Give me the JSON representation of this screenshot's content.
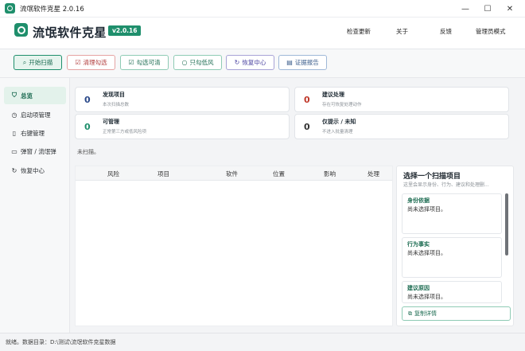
{
  "window": {
    "title": "流氓软件克星 2.0.16",
    "controls": {
      "minimize": "—",
      "maximize": "☐",
      "close": "✕"
    }
  },
  "header": {
    "brand": "流氓软件克星",
    "version": "v2.0.16",
    "menu": [
      "检查更新",
      "关于",
      "反馈",
      "管理员模式"
    ]
  },
  "toolbar": {
    "buttons": [
      {
        "label": "开始扫描",
        "icon": "search-icon"
      },
      {
        "label": "清理勾选",
        "icon": "checkbox-icon"
      },
      {
        "label": "勾选可清",
        "icon": "checkbox-icon"
      },
      {
        "label": "只勾低风",
        "icon": "circle-icon"
      },
      {
        "label": "恢复中心",
        "icon": "restore-icon"
      },
      {
        "label": "证据报告",
        "icon": "report-icon"
      }
    ]
  },
  "sidebar": {
    "items": [
      {
        "label": "总览",
        "icon": "shield-icon",
        "active": true
      },
      {
        "label": "启动项管理",
        "icon": "clock-icon",
        "active": false
      },
      {
        "label": "右键管理",
        "icon": "file-icon",
        "active": false
      },
      {
        "label": "弹窗 / 流氓弹",
        "icon": "window-icon",
        "active": false
      },
      {
        "label": "恢复中心",
        "icon": "restore-icon",
        "active": false
      }
    ]
  },
  "summary": {
    "cards": [
      {
        "value": "0",
        "title": "发现项目",
        "desc": "本次扫描总数",
        "color": "#2b4a8a"
      },
      {
        "value": "0",
        "title": "建议处理",
        "desc": "存在可恢复处理动作",
        "color": "#c0392b"
      },
      {
        "value": "0",
        "title": "可管理",
        "desc": "正常第三方或低风险项",
        "color": "#1f8f6c"
      },
      {
        "value": "0",
        "title": "仅提示 / 未知",
        "desc": "不进入批量清理",
        "color": "#333333"
      }
    ]
  },
  "status_message": "未扫描。",
  "table": {
    "columns": [
      "风险",
      "项目",
      "软件",
      "位置",
      "影响",
      "处理"
    ],
    "rows": []
  },
  "detail": {
    "title": "选择一个扫描项目",
    "subtitle": "这里会显示身份、行为、建议和处理删...",
    "sections": [
      {
        "heading": "身份依据",
        "body": "尚未选择项目。"
      },
      {
        "heading": "行为事实",
        "body": "尚未选择项目。"
      },
      {
        "heading": "建议原因",
        "body": "尚未选择项目。"
      }
    ],
    "copy_label": "复制详情"
  },
  "statusbar": {
    "text": "就绪。数据目录：D:\\测试\\流氓软件克星数据"
  }
}
